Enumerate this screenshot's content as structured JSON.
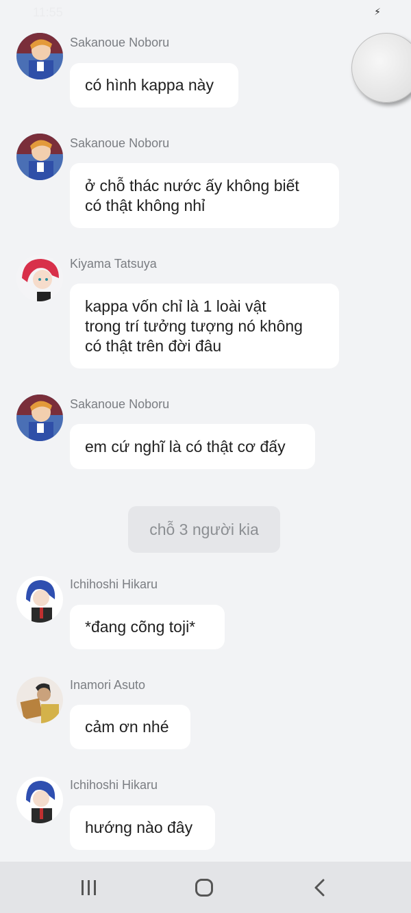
{
  "status_bar": {
    "time": "11:55"
  },
  "messages": [
    {
      "sender": "Sakanoue Noboru",
      "text": "có hình kappa này"
    },
    {
      "sender": "Sakanoue Noboru",
      "text": "ở chỗ thác nước ấy không biết\ncó thật không nhỉ"
    },
    {
      "sender": "Kiyama Tatsuya",
      "text": "kappa vốn chỉ là 1 loài vật\ntrong trí tưởng tượng nó không\ncó thật trên đời đâu"
    },
    {
      "sender": "Sakanoue Noboru",
      "text": "em cứ nghĩ là có thật cơ đấy"
    },
    {
      "sender": "Ichihoshi Hikaru",
      "text": "*đang cõng toji*"
    },
    {
      "sender": "Inamori Asuto",
      "text": "cảm ơn nhé"
    },
    {
      "sender": "Ichihoshi Hikaru",
      "text": "hướng nào đây"
    }
  ],
  "system_message": "chỗ 3 người kia",
  "nav": {
    "recents": "recents-icon",
    "home": "home-icon",
    "back": "back-icon"
  },
  "colors": {
    "background": "#f2f3f5",
    "bubble": "#ffffff",
    "system_pill": "#e5e6e9",
    "nav_bar": "#e3e4e7"
  }
}
